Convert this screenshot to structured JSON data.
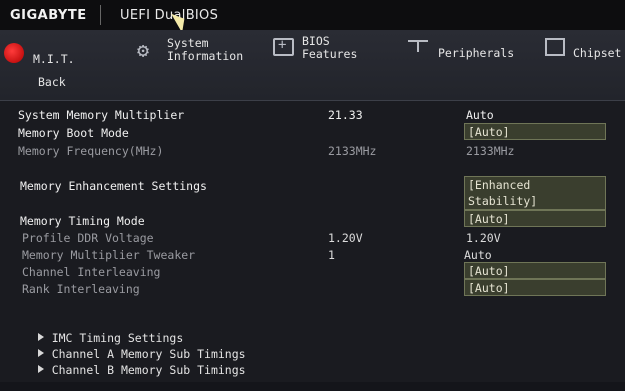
{
  "header": {
    "brand": "GIGABYTE",
    "title": "UEFI DualBIOS"
  },
  "nav": {
    "mit": "M.I.T.",
    "back": "Back",
    "system_info": "System\nInformation",
    "bios_features": "BIOS\nFeatures",
    "peripherals": "Peripherals",
    "chipset": "Chipset"
  },
  "settings": {
    "sys_mem_mult": {
      "label": "System Memory Multiplier",
      "current": "21.33",
      "setting": "Auto"
    },
    "mem_boot_mode": {
      "label": "Memory Boot Mode",
      "setting": "[Auto]"
    },
    "mem_freq": {
      "label": "Memory Frequency(MHz)",
      "current": "2133MHz",
      "setting": "2133MHz"
    },
    "mem_enh": {
      "label": "Memory Enhancement Settings",
      "setting": "[Enhanced\nStability]"
    },
    "mem_timing_mode": {
      "label": "Memory Timing Mode",
      "setting": "[Auto]"
    },
    "profile_ddr": {
      "label": "Profile DDR Voltage",
      "current": "1.20V",
      "setting": "1.20V"
    },
    "mem_mult_tweak": {
      "label": "Memory Multiplier Tweaker",
      "current": "1",
      "setting": "Auto"
    },
    "chan_interleave": {
      "label": "Channel Interleaving",
      "setting": "[Auto]"
    },
    "rank_interleave": {
      "label": "Rank Interleaving",
      "setting": "[Auto]"
    }
  },
  "submenus": {
    "imc": "IMC Timing Settings",
    "chan_a": "Channel A Memory Sub Timings",
    "chan_b": "Channel B Memory Sub Timings"
  }
}
